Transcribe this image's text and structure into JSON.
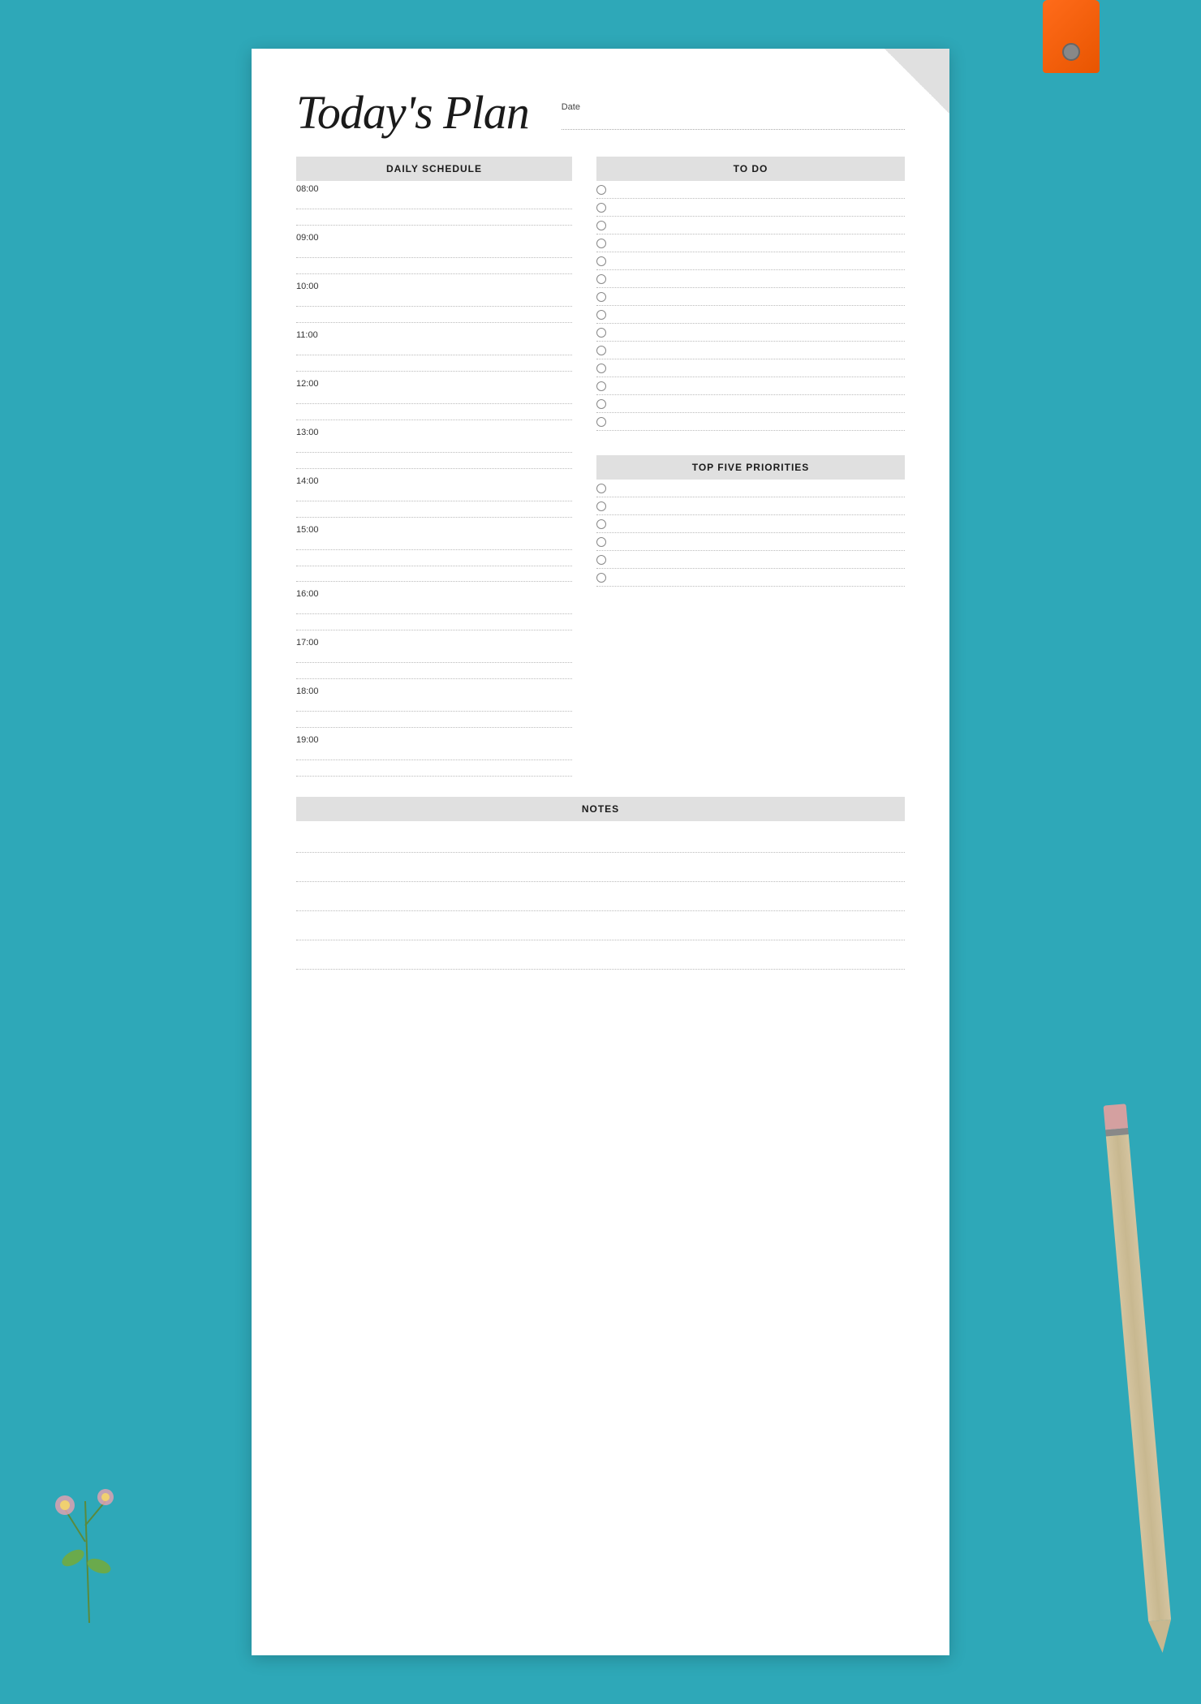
{
  "page": {
    "title": "Today's Plan",
    "date_label": "Date",
    "background_color": "#2ea8b8"
  },
  "daily_schedule": {
    "header": "DAILY SCHEDULE",
    "times": [
      "08:00",
      "09:00",
      "10:00",
      "11:00",
      "12:00",
      "13:00",
      "14:00",
      "15:00",
      "16:00",
      "17:00",
      "18:00",
      "19:00"
    ]
  },
  "todo": {
    "header": "TO DO",
    "items_count": 14
  },
  "top_five_priorities": {
    "header": "TOP FIVE PRIORITIES",
    "items_count": 6
  },
  "notes": {
    "header": "NOTES",
    "lines_count": 5
  }
}
